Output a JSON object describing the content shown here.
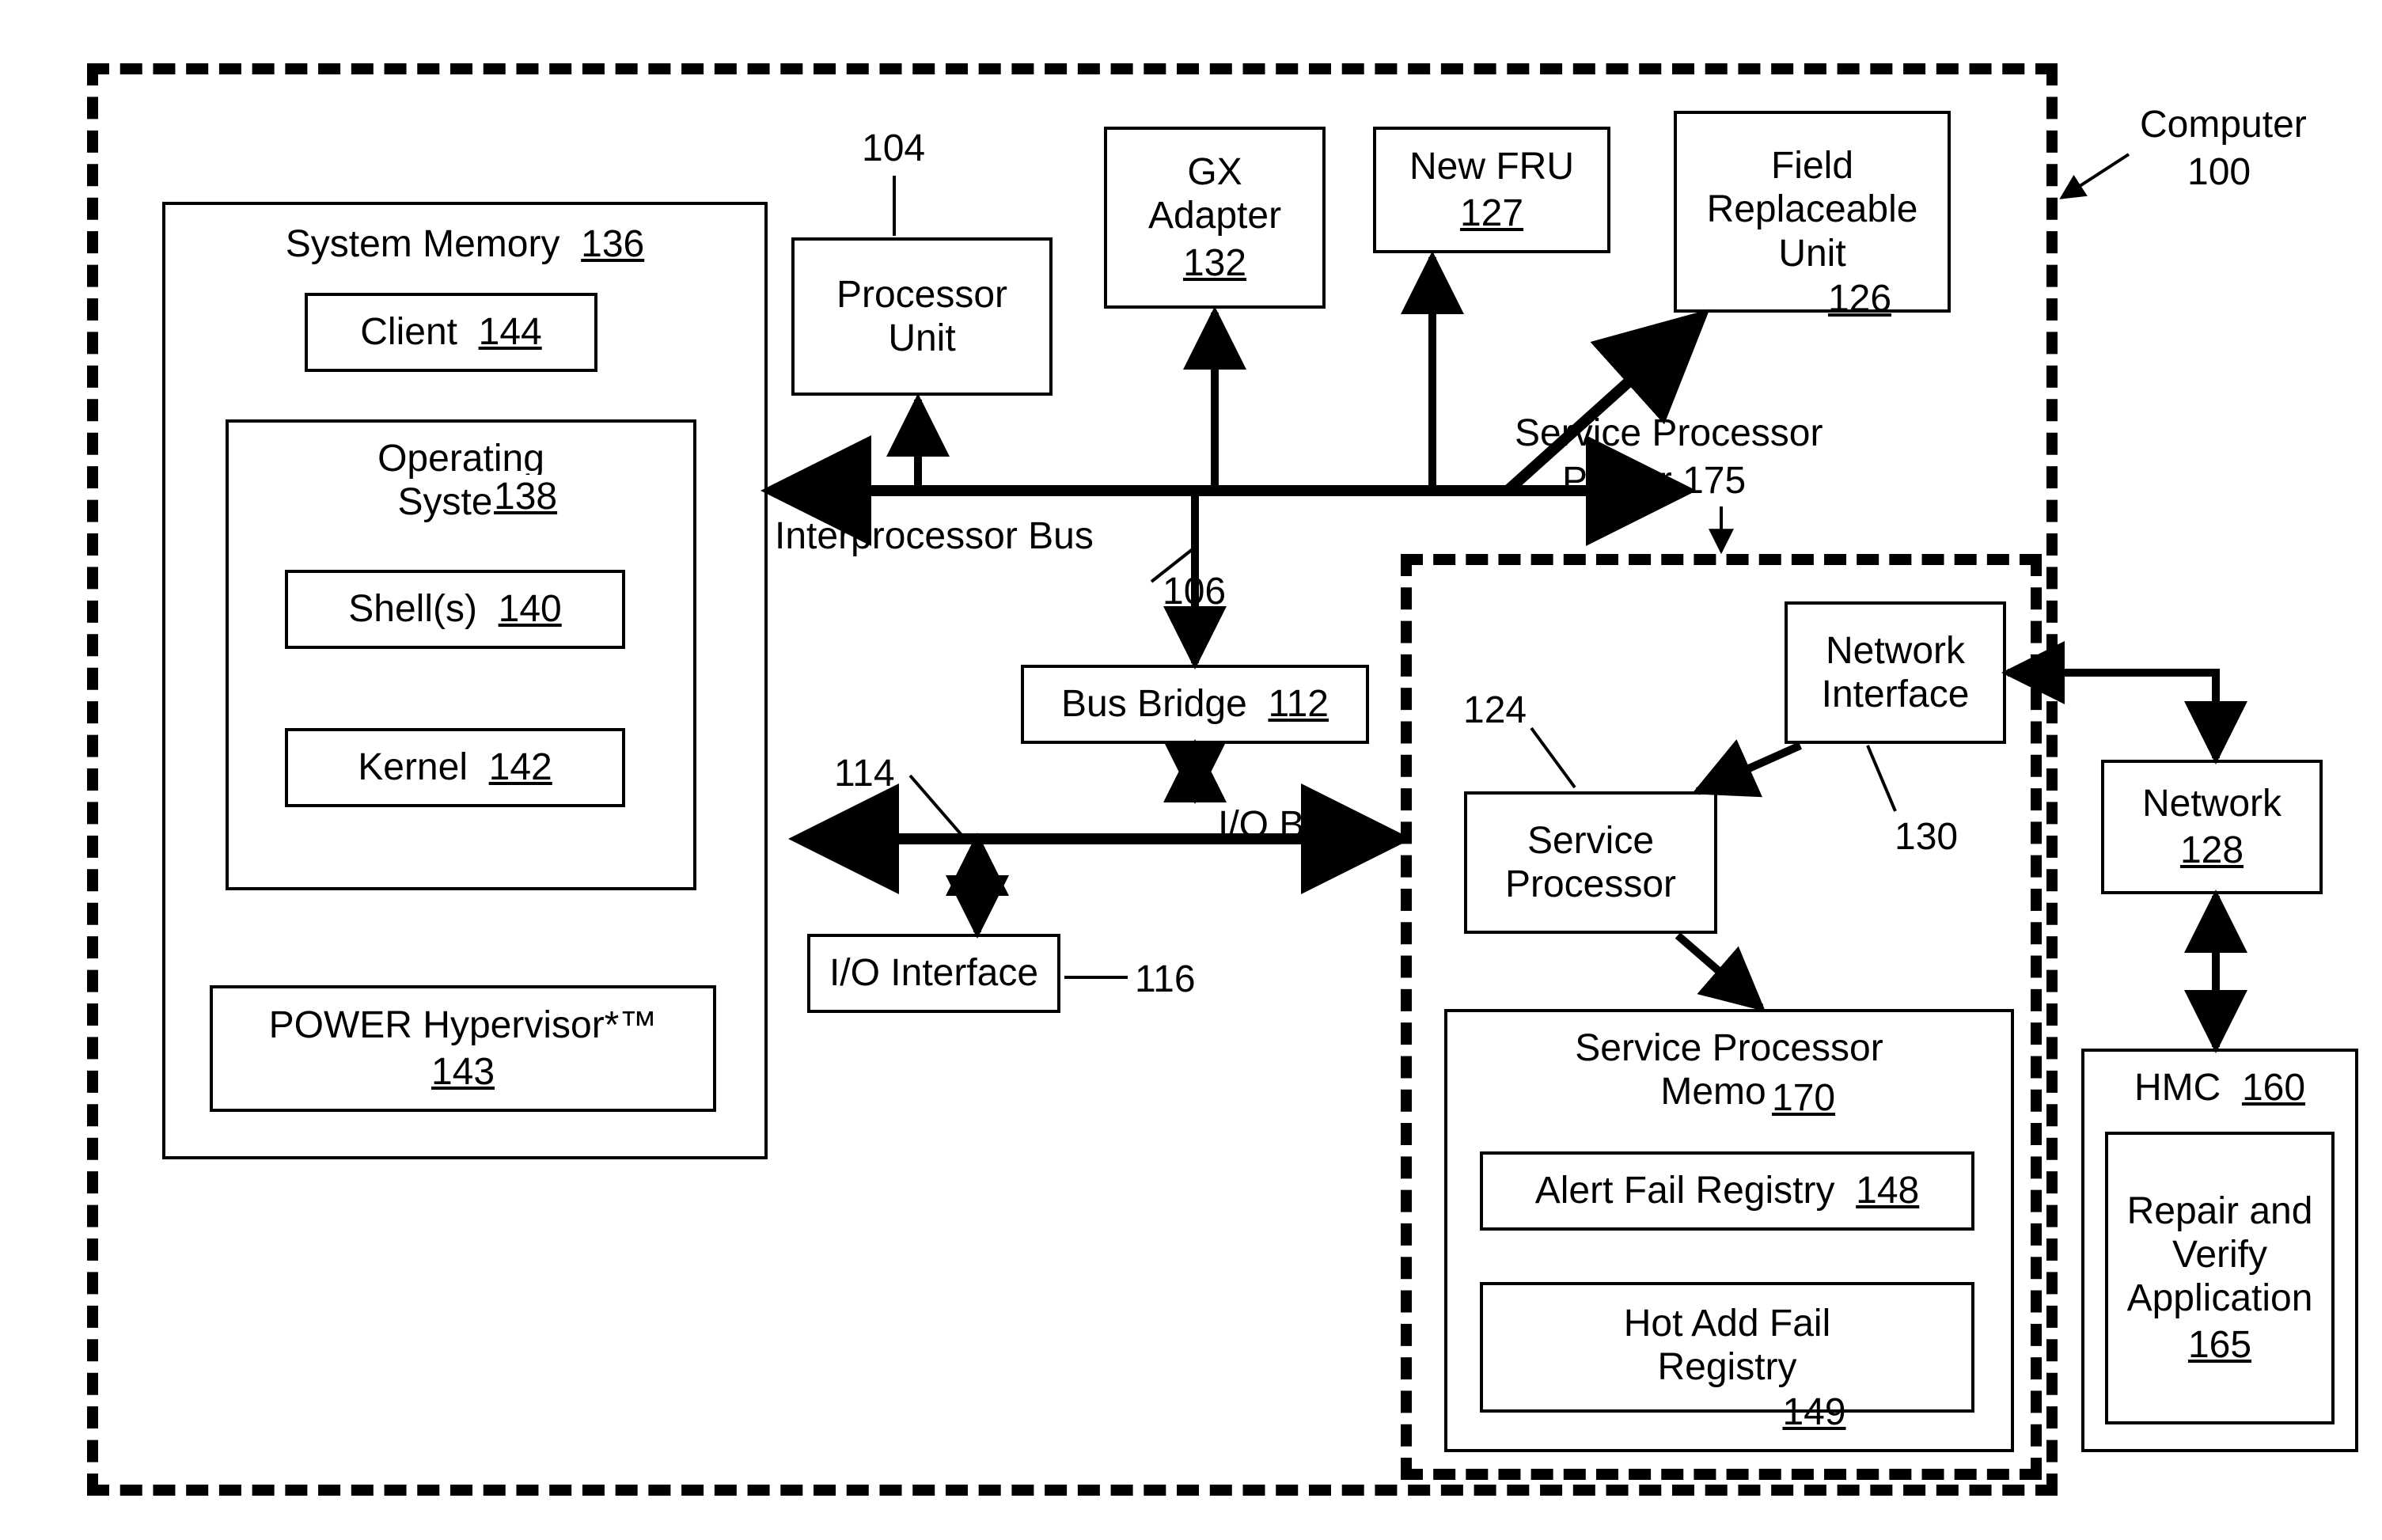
{
  "labels": {
    "computer": "Computer",
    "computer_ref": "100",
    "sp_planar": "Service Processor",
    "sp_planar2": "Planar  175",
    "interproc_bus": "Interprocessor Bus",
    "interproc_bus_ref": "106",
    "io_bus": "I/O Bus",
    "ref_104": "104",
    "ref_114": "114",
    "ref_116": "116",
    "ref_124": "124",
    "ref_130": "130"
  },
  "system_memory": {
    "title": "System Memory",
    "ref": "136",
    "client": {
      "title": "Client",
      "ref": "144"
    },
    "os": {
      "title": "Operating\nSystem",
      "ref": "138"
    },
    "shells": {
      "title": "Shell(s)",
      "ref": "140"
    },
    "kernel": {
      "title": "Kernel",
      "ref": "142"
    },
    "hyperv": {
      "title": "POWER Hypervisor*™",
      "ref": "143"
    }
  },
  "top_row": {
    "proc_unit": {
      "title": "Processor\nUnit"
    },
    "gx": {
      "title": "GX\nAdapter",
      "ref": "132"
    },
    "new_fru": {
      "title": "New FRU",
      "ref": "127"
    },
    "fru": {
      "title": "Field\nReplaceable\nUnit",
      "ref": "126"
    }
  },
  "mid": {
    "bus_bridge": {
      "title": "Bus Bridge",
      "ref": "112"
    },
    "io_if": {
      "title": "I/O Interface"
    }
  },
  "sp": {
    "net_if": {
      "title": "Network\nInterface"
    },
    "svc_proc": {
      "title": "Service\nProcessor"
    },
    "mem": {
      "title": "Service Processor\nMemory",
      "ref": "170"
    },
    "alert": {
      "title": "Alert Fail Registry",
      "ref": "148"
    },
    "hot": {
      "title": "Hot Add Fail\nRegistry",
      "ref": "149"
    }
  },
  "right": {
    "network": {
      "title": "Network",
      "ref": "128"
    },
    "hmc": {
      "title": "HMC",
      "ref": "160"
    },
    "repair": {
      "title": "Repair and\nVerify\nApplication",
      "ref": "165"
    }
  }
}
